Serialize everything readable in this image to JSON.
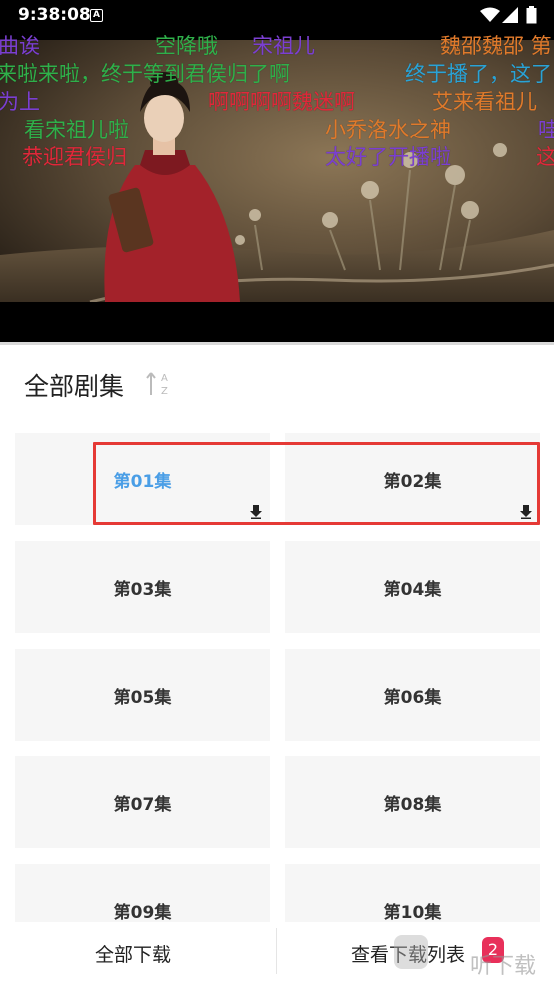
{
  "status_bar": {
    "time": "9:38:08",
    "notification_letter": "A"
  },
  "danmaku": [
    {
      "text": "曲诶",
      "color": "#7b3fd1"
    },
    {
      "text": "空降哦",
      "color": "#2fb04a"
    },
    {
      "text": "宋祖儿",
      "color": "#7b3fd1"
    },
    {
      "text": "魏邵魏邵 第",
      "color": "#e07a2b"
    },
    {
      "text": "来啦来啦，终于等到君侯归了啊",
      "color": "#2fb04a"
    },
    {
      "text": "终于播了，这了",
      "color": "#2aa3d6"
    },
    {
      "text": "为上",
      "color": "#7b3fd1"
    },
    {
      "text": "啊啊啊啊魏迷啊",
      "color": "#e0283a"
    },
    {
      "text": "艾来看祖儿",
      "color": "#e07a2b"
    },
    {
      "text": "看宋祖儿啦",
      "color": "#2fb04a"
    },
    {
      "text": "小乔洛水之神",
      "color": "#e07a2b"
    },
    {
      "text": "哇",
      "color": "#7b3fd1"
    },
    {
      "text": "恭迎君侯归",
      "color": "#e0283a"
    },
    {
      "text": "太好了开播啦",
      "color": "#7b3fd1"
    },
    {
      "text": "这",
      "color": "#e0283a"
    }
  ],
  "episodes_panel": {
    "title": "全部剧集",
    "sort_icon": "sort-az-icon",
    "episodes": [
      {
        "label": "第01集",
        "active": true,
        "downloaded": true
      },
      {
        "label": "第02集",
        "active": false,
        "downloaded": true
      },
      {
        "label": "第03集",
        "active": false,
        "downloaded": false
      },
      {
        "label": "第04集",
        "active": false,
        "downloaded": false
      },
      {
        "label": "第05集",
        "active": false,
        "downloaded": false
      },
      {
        "label": "第06集",
        "active": false,
        "downloaded": false
      },
      {
        "label": "第07集",
        "active": false,
        "downloaded": false
      },
      {
        "label": "第08集",
        "active": false,
        "downloaded": false
      },
      {
        "label": "第09集",
        "active": false,
        "downloaded": false
      },
      {
        "label": "第10集",
        "active": false,
        "downloaded": false
      }
    ],
    "active_color": "#4a9ee6",
    "highlight_color": "#e53935"
  },
  "bottom_bar": {
    "download_all_label": "全部下载",
    "view_list_label": "查看下载列表",
    "badge_count": "2",
    "badge_color": "#e8305a"
  },
  "watermark": {
    "text": "听下载"
  }
}
